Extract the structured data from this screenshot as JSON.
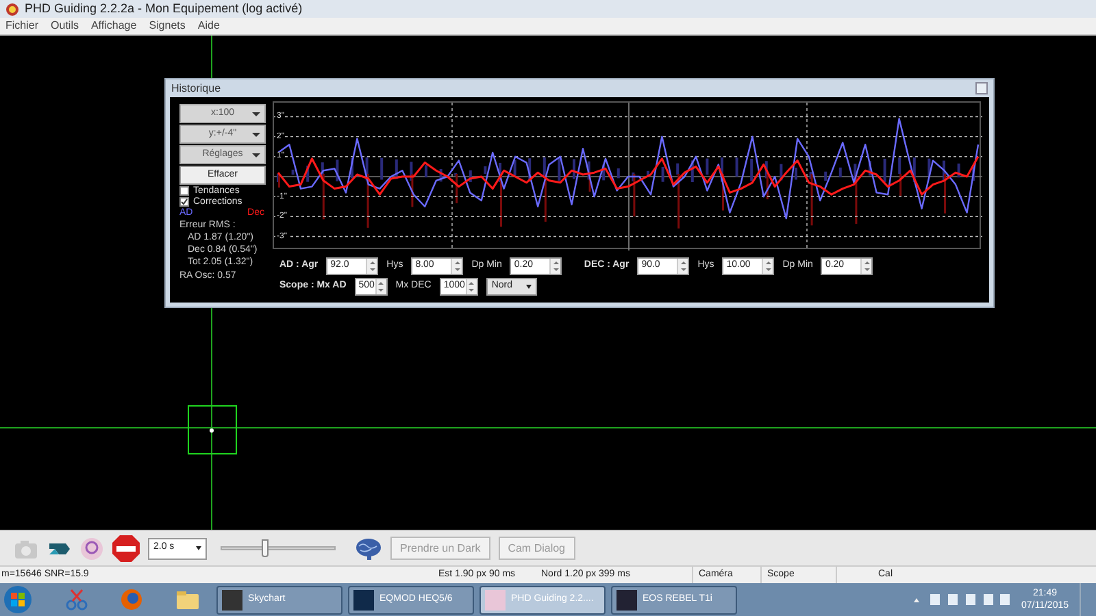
{
  "window": {
    "title": "PHD Guiding 2.2.2a - Mon Equipement (log activé)"
  },
  "menu": [
    "Fichier",
    "Outils",
    "Affichage",
    "Signets",
    "Aide"
  ],
  "history": {
    "title": "Historique",
    "dropdowns": [
      "x:100",
      "y:+/-4\"",
      "Réglages"
    ],
    "clear_button": "Effacer",
    "checkboxes": [
      {
        "label": "Tendances",
        "checked": false
      },
      {
        "label": "Corrections",
        "checked": true
      }
    ],
    "rms_title": "Erreur RMS :",
    "rms_lines": [
      "AD 1.87 (1.20\")",
      "Dec 0.84 (0.54\")",
      "Tot 2.05 (1.32\")"
    ],
    "ra_osc": "RA Osc: 0.57",
    "chart_data": {
      "type": "line",
      "grid": true,
      "ylim": [
        -3.7,
        3.7
      ],
      "yticks": [
        {
          "value": 3,
          "label": "3\""
        },
        {
          "value": 2,
          "label": "2\""
        },
        {
          "value": 1,
          "label": "1\""
        },
        {
          "value": -1,
          "label": "-1\""
        },
        {
          "value": -2,
          "label": "-2\""
        },
        {
          "value": -3,
          "label": "-3\""
        }
      ],
      "series": [
        {
          "name": "AD",
          "color": "#6a6aff",
          "values": [
            1.2,
            1.6,
            -0.6,
            -0.5,
            0.3,
            0.4,
            -0.8,
            1.9,
            -0.4,
            -0.6,
            0,
            0.3,
            -0.9,
            -1.5,
            -0.2,
            0,
            0.8,
            -0.8,
            -1.2,
            1.2,
            -0.6,
            1.0,
            0.7,
            -1.5,
            0.6,
            1.0,
            -1.4,
            1.4,
            -1,
            0.9,
            -0.7,
            0,
            0,
            -0.9,
            2.0,
            -0.5,
            0,
            1.0,
            -0.7,
            0.6,
            -1.8,
            -0.3,
            2.0,
            -1.0,
            0,
            -2.1,
            1.9,
            1.0,
            -1.2,
            0.2,
            1.7,
            -0.3,
            1.6,
            -0.8,
            -0.9,
            2.9,
            0.6,
            -1.6,
            0.8,
            0.3,
            -0.4,
            -1.8,
            1.6
          ]
        },
        {
          "name": "Dec",
          "color": "#ff1a1a",
          "values": [
            0.2,
            -0.5,
            -0.4,
            0.9,
            -0.2,
            -0.6,
            -0.5,
            0.1,
            -0.1,
            -0.9,
            -0.1,
            0,
            0,
            0.7,
            0.3,
            0,
            -0.5,
            -0.1,
            0,
            -0.6,
            0.3,
            0,
            -0.3,
            0.2,
            -0.2,
            -0.3,
            0.3,
            0.1,
            0.2,
            0.4,
            -0.6,
            -0.5,
            -0.2,
            0.1,
            0.9,
            -0.4,
            0.2,
            0.5,
            -0.3,
            0.5,
            -0.8,
            -0.6,
            -0.3,
            0.6,
            -0.5,
            0.2,
            0.8,
            -0.3,
            -0.5,
            -0.9,
            -0.6,
            -0.4,
            0.3,
            0.1,
            -0.5,
            -0.2,
            0.3,
            -0.9,
            -0.4,
            -0.2,
            0.2,
            0,
            1.0
          ]
        }
      ]
    },
    "ra_params": {
      "label": "AD : Agr",
      "agr": "92.0",
      "hys_label": "Hys",
      "hys": "8.00",
      "min_label": "Dp Min",
      "min": "0.20"
    },
    "dec_params": {
      "label": "DEC : Agr",
      "agr": "90.0",
      "hys_label": "Hys",
      "hys": "10.00",
      "min_label": "Dp Min",
      "min": "0.20"
    },
    "scope_params": {
      "label": "Scope : Mx AD",
      "mx_ad": "500",
      "mx_dec_label": "Mx DEC",
      "mx_dec": "1000",
      "direction": "Nord"
    }
  },
  "toolbar": {
    "exposure": "2.0 s",
    "gamma": {
      "level": 0.38
    },
    "dark_button": "Prendre un Dark",
    "cam_button": "Cam Dialog"
  },
  "status_bar": [
    "m=15646 SNR=15.9",
    "Est 1.90 px 90 ms",
    "Nord 1.20 px 399 ms",
    "Caméra",
    "Scope",
    "Cal"
  ],
  "taskbar": {
    "tasks": [
      {
        "label": "Skychart",
        "selected": false
      },
      {
        "label": "EQMOD HEQ5/6",
        "selected": false
      },
      {
        "label": "PHD Guiding 2.2....",
        "selected": true
      },
      {
        "label": "EOS REBEL T1i",
        "selected": false
      }
    ],
    "time": "21:49",
    "date": "07/11/2015"
  }
}
